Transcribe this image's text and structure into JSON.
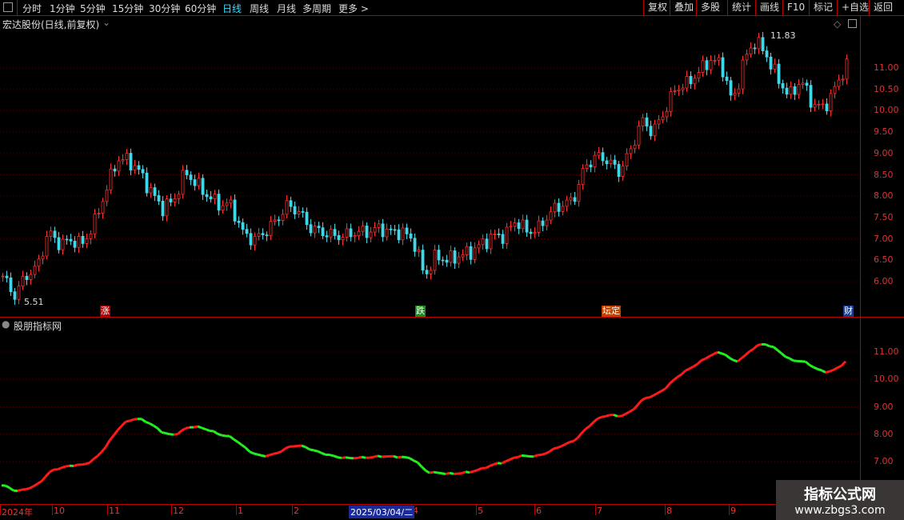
{
  "toolbar": {
    "periods": [
      "分时",
      "1分钟",
      "5分钟",
      "15分钟",
      "30分钟",
      "60分钟",
      "日线",
      "周线",
      "月线",
      "多周期",
      "更多 >"
    ],
    "active": "日线",
    "right_buttons": [
      "复权",
      "叠加",
      "多股",
      "统计",
      "画线",
      "F10",
      "标记",
      "+自选",
      "返回"
    ]
  },
  "main": {
    "title": "宏达股份(日线,前复权)",
    "high_label": "11.83",
    "low_label": "5.51",
    "y_ticks": [
      "11.00",
      "10.50",
      "10.00",
      "9.50",
      "9.00",
      "8.50",
      "8.00",
      "7.50",
      "7.00",
      "6.50",
      "6.00"
    ],
    "events": [
      {
        "text": "涨",
        "color": "#b00000"
      },
      {
        "text": "跌",
        "color": "#1a8a1a"
      },
      {
        "text": "坛定",
        "color": "#c04000"
      },
      {
        "text": "财",
        "color": "#1a3a8a"
      }
    ]
  },
  "indicator": {
    "title": "股朋指标网",
    "y_ticks": [
      "11.00",
      "10.00",
      "9.00",
      "8.00",
      "7.00"
    ],
    "rise_color": "#ff1a1a",
    "fall_color": "#22ee22"
  },
  "time_axis": {
    "labels": [
      "2024年",
      "10",
      "11",
      "12",
      "1",
      "2",
      "4",
      "5",
      "6",
      "7",
      "8",
      "9"
    ],
    "cursor_date": "2025/03/04/二"
  },
  "watermark": {
    "title": "指标公式网",
    "url": "www.zbgs3.com"
  },
  "chart_data": {
    "type": "candlestick",
    "ylim": [
      5.5,
      11.9
    ],
    "closes": [
      6.13,
      5.66,
      6.13,
      6.32,
      7.16,
      6.88,
      6.97,
      6.88,
      7.35,
      8.1,
      8.85,
      8.85,
      8.57,
      8.1,
      7.72,
      7.9,
      8.57,
      8.28,
      8.0,
      7.8,
      7.8,
      7.16,
      6.97,
      7.16,
      7.44,
      7.8,
      7.62,
      7.25,
      7.16,
      7.07,
      7.07,
      7.16,
      7.16,
      7.25,
      7.16,
      7.16,
      6.97,
      6.13,
      6.6,
      6.5,
      6.6,
      6.69,
      6.88,
      7.07,
      7.07,
      7.44,
      7.16,
      7.25,
      7.62,
      7.8,
      7.9,
      8.66,
      8.94,
      8.85,
      8.57,
      9.03,
      9.78,
      9.5,
      9.97,
      10.53,
      10.63,
      10.9,
      11.19,
      11.1,
      10.16,
      11.19,
      11.65,
      11.28,
      10.72,
      10.34,
      10.72,
      10.16,
      10.06,
      10.53,
      11.1
    ]
  }
}
